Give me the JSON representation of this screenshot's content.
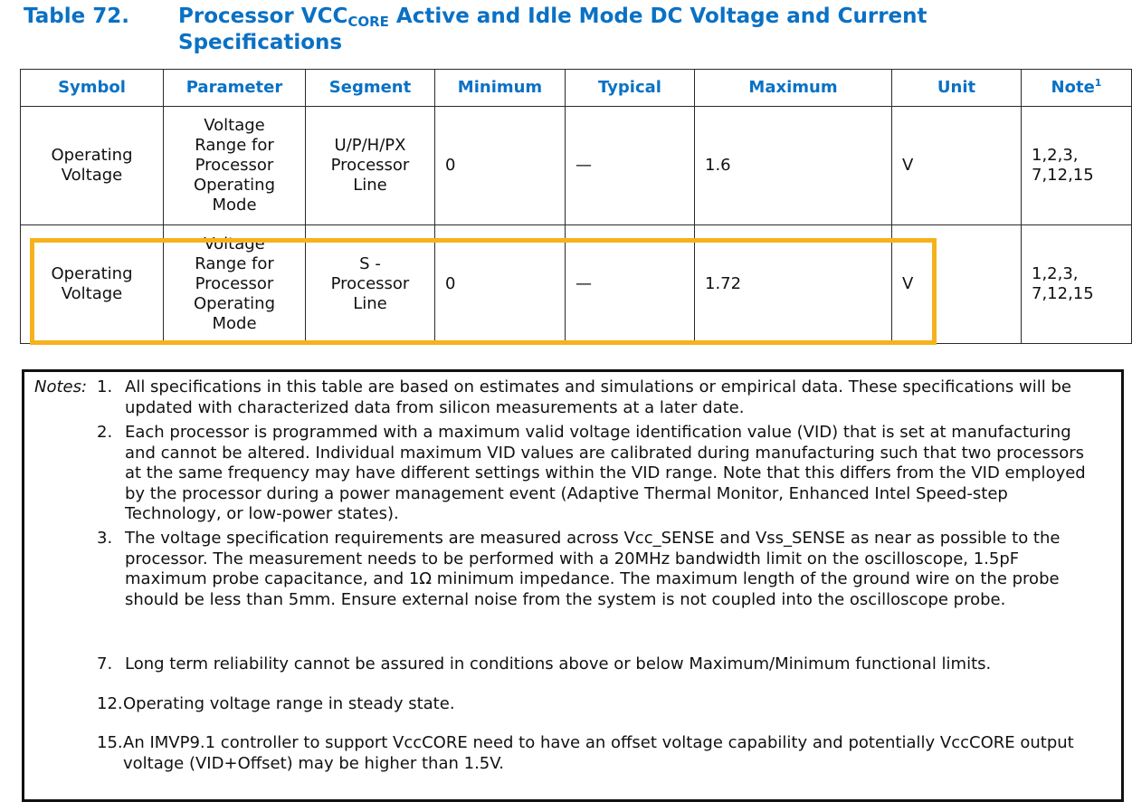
{
  "title": {
    "number": "Table 72.",
    "text_before_sub": "Processor VCC",
    "subscript": "CORE",
    "text_after_sub": " Active and Idle Mode DC Voltage and Current Specifications"
  },
  "table": {
    "headers": [
      "Symbol",
      "Parameter",
      "Segment",
      "Minimum",
      "Typical",
      "Maximum",
      "Unit",
      "Note"
    ],
    "note_header_superscript": "1",
    "rows": [
      {
        "symbol": "Operating Voltage",
        "parameter": "Voltage Range for Processor Operating Mode",
        "segment": "U/P/H/PX Processor Line",
        "minimum": "0",
        "typical": "—",
        "maximum": "1.6",
        "unit": "V",
        "note": "1,2,3, 7,12,15",
        "highlighted": false
      },
      {
        "symbol": "Operating Voltage",
        "parameter": "Voltage Range for Processor Operating Mode",
        "segment": "S - Processor Line",
        "minimum": "0",
        "typical": "—",
        "maximum": "1.72",
        "unit": "V",
        "note": "1,2,3, 7,12,15",
        "highlighted": true
      }
    ],
    "highlight_color": "#f5b21d"
  },
  "notes": {
    "label": "Notes:",
    "items": [
      {
        "num": "1.",
        "text": "All specifications in this table are based on estimates and simulations or empirical data. These specifications will be updated with characterized data from silicon measurements at a later date."
      },
      {
        "num": "2.",
        "text": "Each processor is programmed with a maximum valid voltage identification value (VID) that is set at manufacturing and cannot be altered. Individual maximum VID values are calibrated during manufacturing such that two processors at the same frequency may have different settings within the VID range. Note that this differs from the VID employed by the processor during a power management event (Adaptive Thermal Monitor, Enhanced Intel Speed-step Technology, or low-power states)."
      },
      {
        "num": "3.",
        "text": "The voltage specification requirements are measured across Vcc_SENSE and Vss_SENSE as near as possible to the processor. The measurement needs to be performed with a 20MHz bandwidth limit on the oscilloscope, 1.5pF maximum probe capacitance, and 1Ω minimum impedance. The maximum length of the ground wire on the probe should be less than 5mm. Ensure external noise from the system is not coupled into the oscilloscope probe."
      },
      {
        "num": "7.",
        "text": "Long term reliability cannot be assured in conditions above or below Maximum/Minimum functional limits."
      },
      {
        "num": "12.",
        "text": "Operating voltage range in steady state."
      },
      {
        "num": "15.",
        "text": "An IMVP9.1 controller to support VccCORE need to have an offset voltage capability and potentially VccCORE output voltage (VID+Offset) may be higher than 1.5V."
      }
    ]
  },
  "colors": {
    "heading_blue": "#0a71c4",
    "highlight": "#f5b21d"
  }
}
